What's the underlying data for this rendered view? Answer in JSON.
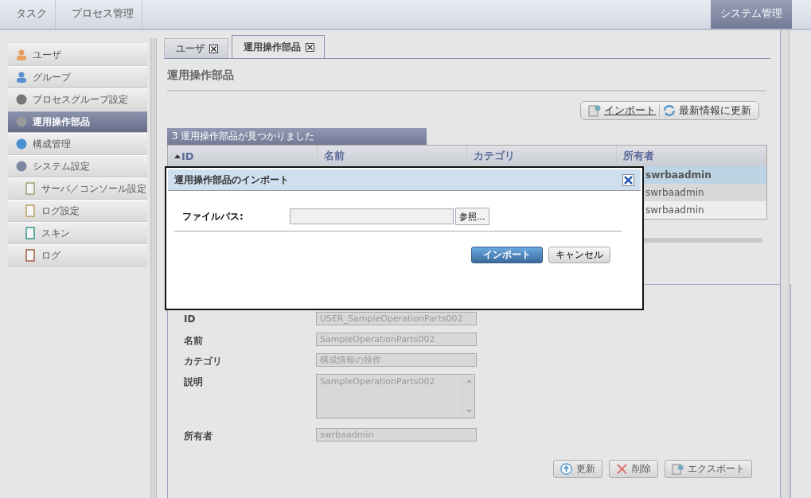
{
  "top_tabs": [
    {
      "label": "タスク",
      "selected": false
    },
    {
      "label": "プロセス管理",
      "selected": false
    }
  ],
  "top_right_tab": {
    "label": "システム管理",
    "selected": true
  },
  "sidebar": {
    "items": [
      {
        "label": "ユーザ",
        "selected": false
      },
      {
        "label": "グループ",
        "selected": false
      },
      {
        "label": "プロセスグループ設定",
        "selected": false
      },
      {
        "label": "運用操作部品",
        "selected": true
      },
      {
        "label": "構成管理",
        "selected": false
      },
      {
        "label": "システム設定",
        "selected": false,
        "children": [
          {
            "label": "サーバ／コンソール設定",
            "selected": false
          },
          {
            "label": "ログ設定",
            "selected": false
          },
          {
            "label": "スキン",
            "selected": false
          },
          {
            "label": "ログ",
            "selected": false
          }
        ]
      }
    ]
  },
  "tabs": [
    {
      "label": "ユーザ",
      "selected": false
    },
    {
      "label": "運用操作部品",
      "selected": true
    }
  ],
  "page_title": "運用操作部品",
  "toolbar": [
    {
      "label": "インポート",
      "link": true
    },
    {
      "label": "最新情報に更新",
      "link": false
    }
  ],
  "table": {
    "caption": "3 運用操作部品が見つかりました",
    "columns": [
      {
        "label": "ID",
        "sorted": true
      },
      {
        "label": "名前",
        "sorted": false
      },
      {
        "label": "カテゴリ",
        "sorted": false
      },
      {
        "label": "所有者",
        "sorted": false
      }
    ],
    "rows": [
      {
        "owner": "swrbaadmin",
        "selected": true
      },
      {
        "owner": "swrbaadmin",
        "selected": false
      },
      {
        "owner": "swrbaadmin",
        "selected": false
      }
    ]
  },
  "detail": {
    "fields": [
      {
        "label": "ID",
        "value": "USER_SampleOperationParts002",
        "kind": "input"
      },
      {
        "label": "名前",
        "value": "SampleOperationParts002",
        "kind": "input"
      },
      {
        "label": "カテゴリ",
        "value": "構成情報の操作",
        "kind": "input"
      },
      {
        "label": "説明",
        "value": "SampleOperationParts002",
        "kind": "textarea"
      },
      {
        "label": "所有者",
        "value": "swrbaadmin",
        "kind": "input"
      }
    ],
    "buttons": [
      {
        "label": "更新"
      },
      {
        "label": "削除"
      },
      {
        "label": "エクスポート"
      }
    ]
  },
  "dialog": {
    "title": "運用操作部品のインポート",
    "field_label": "ファイルパス:",
    "browse": "参照...",
    "ok": "インポート",
    "cancel": "キャンセル"
  }
}
